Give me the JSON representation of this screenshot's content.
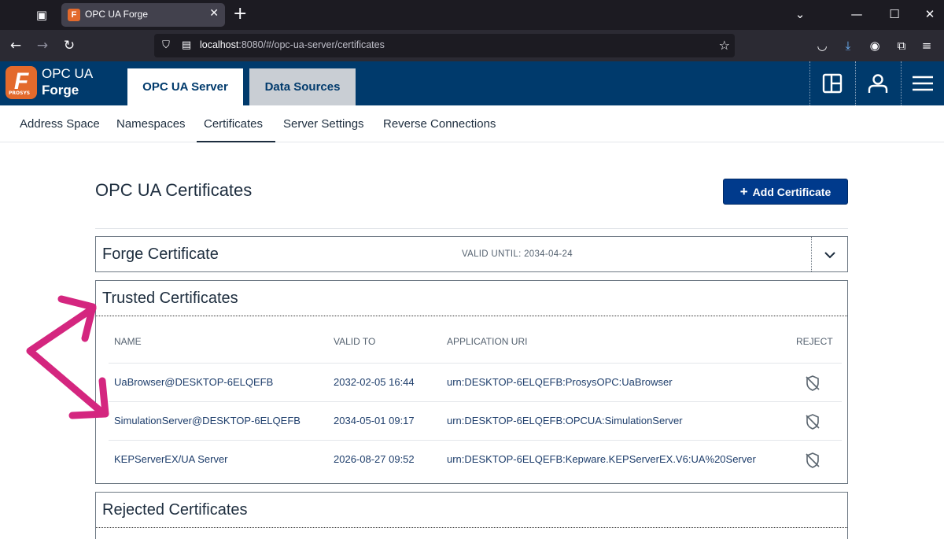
{
  "browser": {
    "tab_title": "OPC UA Forge",
    "url_host": "localhost",
    "url_path": ":8080/#/opc-ua-server/certificates"
  },
  "app": {
    "logo_line1": "OPC UA",
    "logo_line2": "Forge",
    "logo_letter": "F",
    "logo_badge": "PROSYS",
    "main_tabs": [
      {
        "label": "OPC UA Server",
        "active": true
      },
      {
        "label": "Data Sources",
        "active": false
      }
    ],
    "sub_nav": [
      "Address Space",
      "Namespaces",
      "Certificates",
      "Server Settings",
      "Reverse Connections"
    ],
    "sub_nav_active": "Certificates"
  },
  "page": {
    "title": "OPC UA Certificates",
    "add_button_label": "Add Certificate",
    "forge_certificate": {
      "title": "Forge Certificate",
      "valid_until": "VALID UNTIL: 2034-04-24"
    },
    "trusted": {
      "title": "Trusted Certificates",
      "columns": [
        "NAME",
        "VALID TO",
        "APPLICATION URI",
        "REJECT"
      ],
      "rows": [
        {
          "name": "UaBrowser@DESKTOP-6ELQEFB",
          "valid_to": "2032-02-05 16:44",
          "uri": "urn:DESKTOP-6ELQEFB:ProsysOPC:UaBrowser"
        },
        {
          "name": "SimulationServer@DESKTOP-6ELQEFB",
          "valid_to": "2034-05-01 09:17",
          "uri": "urn:DESKTOP-6ELQEFB:OPCUA:SimulationServer"
        },
        {
          "name": "KEPServerEX/UA Server",
          "valid_to": "2026-08-27 09:52",
          "uri": "urn:DESKTOP-6ELQEFB:Kepware.KEPServerEX.V6:UA%20Server"
        }
      ]
    },
    "rejected": {
      "title": "Rejected Certificates"
    }
  },
  "colors": {
    "header_bg": "#003a6c",
    "accent": "#003a8c",
    "annotation_arrow": "#d4267f"
  }
}
